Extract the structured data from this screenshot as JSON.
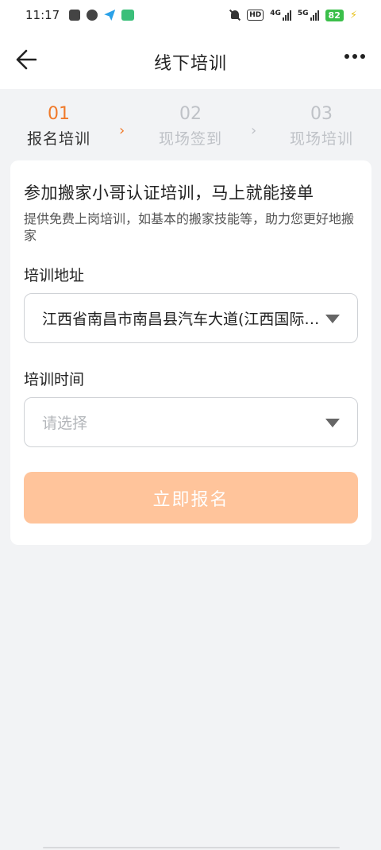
{
  "status_bar": {
    "time": "11:17",
    "hd": "HD",
    "net1": "4G",
    "net2": "5G",
    "battery": "82"
  },
  "nav": {
    "title": "线下培训"
  },
  "steps": [
    {
      "num": "01",
      "label": "报名培训",
      "state": "active"
    },
    {
      "num": "02",
      "label": "现场签到",
      "state": "inactive"
    },
    {
      "num": "03",
      "label": "现场培训",
      "state": "inactive"
    }
  ],
  "card": {
    "title": "参加搬家小哥认证培训，马上就能接单",
    "description": "提供免费上岗培训，如基本的搬家技能等，助力您更好地搬家",
    "address": {
      "label": "培训地址",
      "value": "江西省南昌市南昌县汽车大道(江西国际汽车城)"
    },
    "time": {
      "label": "培训时间",
      "placeholder": "请选择"
    },
    "submit_label": "立即报名"
  },
  "colors": {
    "accent": "#f07a2a",
    "button_disabled": "#ffc49b",
    "inactive": "#bfc2c7",
    "background": "#f2f3f5"
  }
}
